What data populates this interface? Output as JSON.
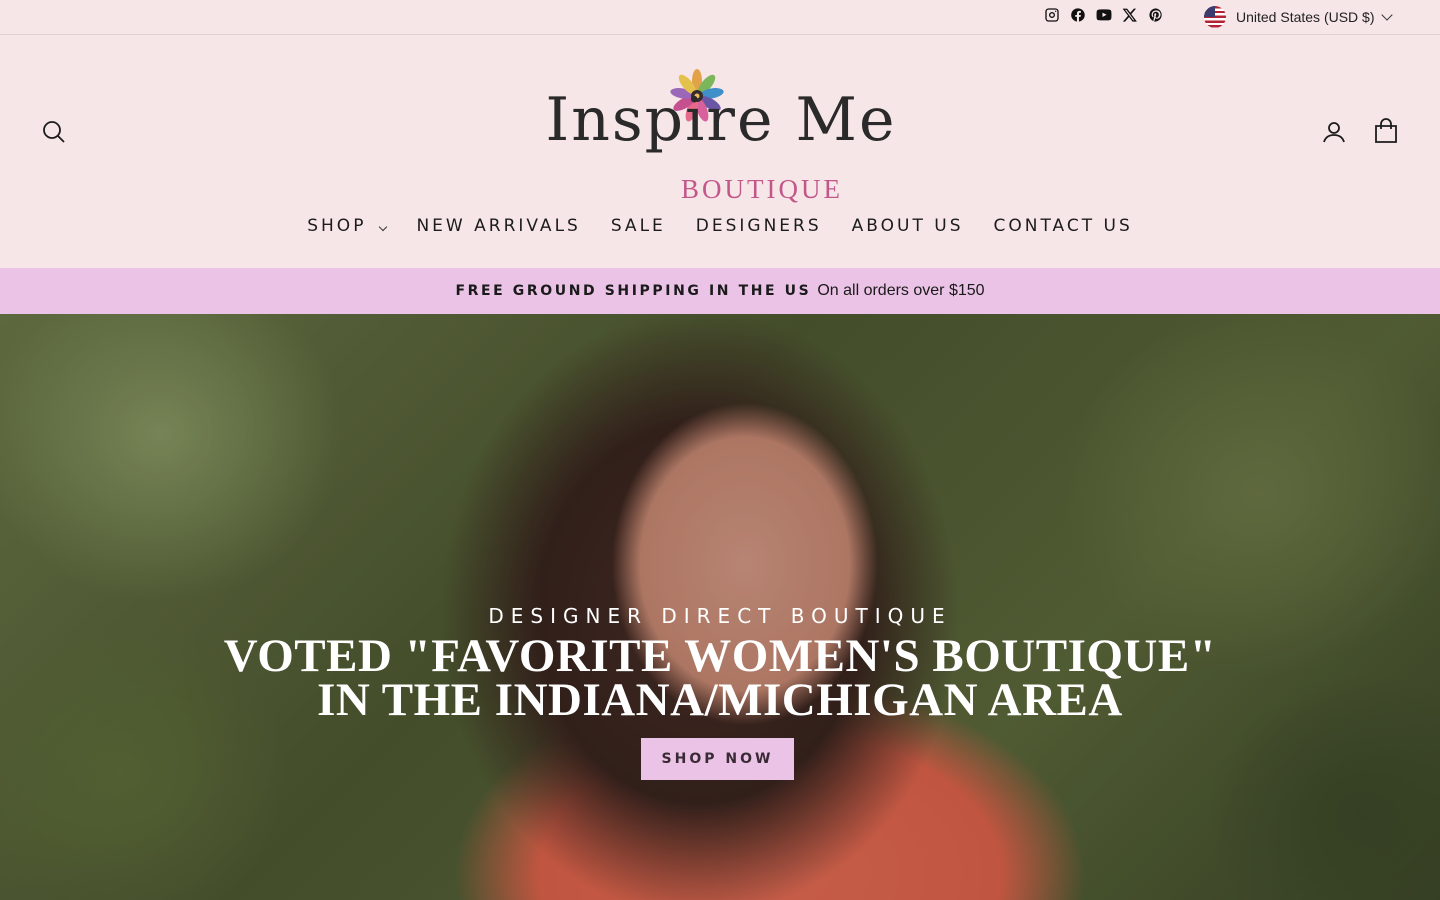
{
  "social": {
    "items": [
      {
        "name": "Instagram",
        "icon": "instagram-icon"
      },
      {
        "name": "Facebook",
        "icon": "facebook-icon"
      },
      {
        "name": "YouTube",
        "icon": "youtube-icon"
      },
      {
        "name": "X",
        "icon": "x-icon"
      },
      {
        "name": "Pinterest",
        "icon": "pinterest-icon"
      }
    ]
  },
  "currency": {
    "label": "United States (USD $)",
    "icon": "us-flag-icon"
  },
  "header": {
    "logo_main": "Inspire Me",
    "logo_sub": "BOUTIQUE",
    "icons": {
      "search": "search-icon",
      "account": "user-icon",
      "cart": "bag-icon"
    }
  },
  "nav": {
    "items": [
      "SHOP",
      "NEW ARRIVALS",
      "SALE",
      "DESIGNERS",
      "ABOUT US",
      "CONTACT US"
    ]
  },
  "announcement": {
    "strong": "FREE GROUND SHIPPING IN THE US",
    "rest": "On all orders over $150"
  },
  "hero": {
    "kicker": "DESIGNER DIRECT BOUTIQUE",
    "title": "VOTED \"FAVORITE WOMEN'S BOUTIQUE\" IN THE INDIANA/MICHIGAN AREA",
    "button": "SHOP NOW"
  },
  "colors": {
    "header_bg": "#f7e6e8",
    "announcement_bg": "#ebc3e6",
    "logo_accent": "#c2588a",
    "button_bg": "#ebc3e6"
  }
}
